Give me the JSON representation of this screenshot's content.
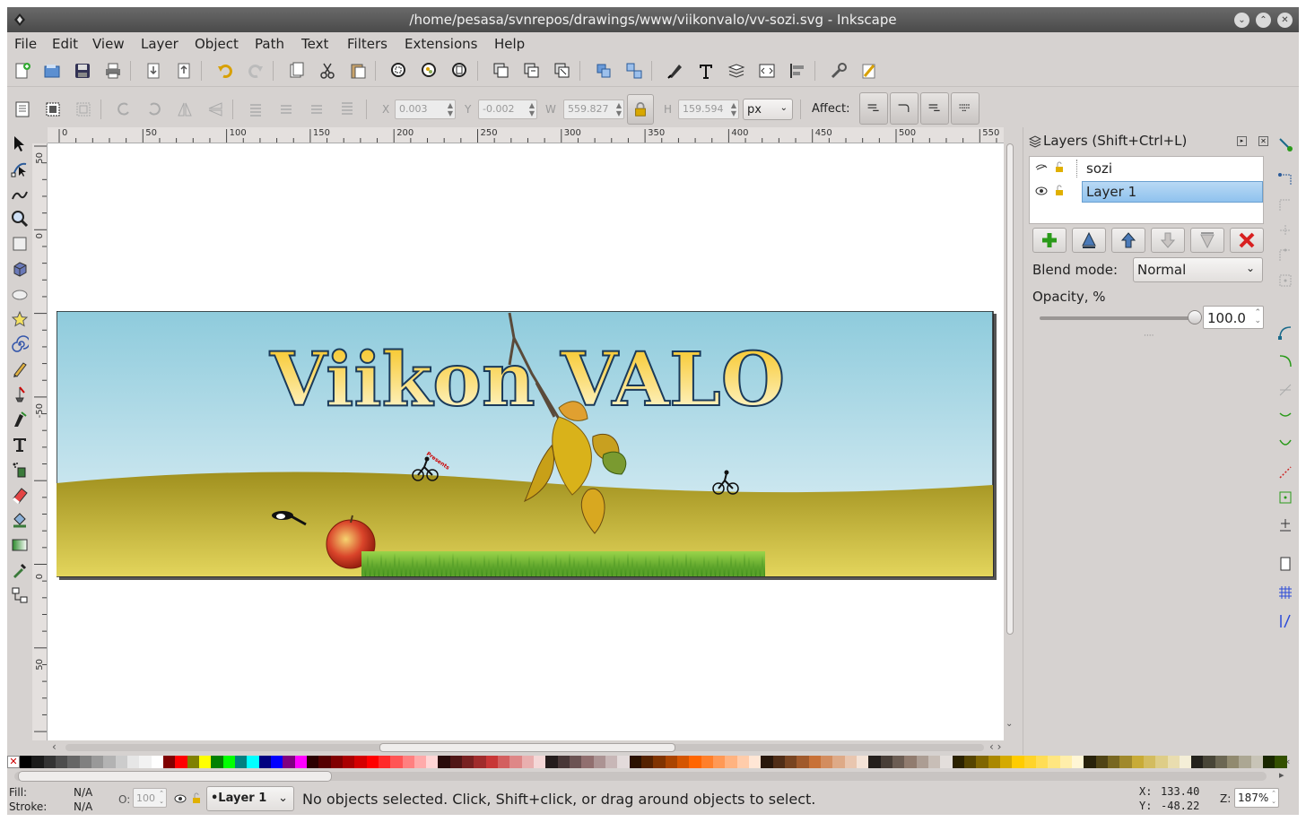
{
  "window": {
    "title": "/home/pesasa/svnrepos/drawings/www/viikonvalo/vv-sozi.svg - Inkscape",
    "buttons": [
      "minimize",
      "maximize",
      "close"
    ]
  },
  "menu": [
    "File",
    "Edit",
    "View",
    "Layer",
    "Object",
    "Path",
    "Text",
    "Filters",
    "Extensions",
    "Help"
  ],
  "toolbar": {
    "x_label": "X",
    "x_value": "0.003",
    "y_label": "Y",
    "y_value": "-0.002",
    "w_label": "W",
    "w_value": "559.827",
    "h_label": "H",
    "h_value": "159.594",
    "unit": "px",
    "affect_label": "Affect:"
  },
  "ruler": {
    "horizontal": [
      "0",
      "50",
      "100",
      "150",
      "200",
      "250",
      "300",
      "350",
      "400",
      "450",
      "500",
      "550"
    ],
    "vertical": [
      "50",
      "0",
      "-50",
      "0",
      "50"
    ]
  },
  "artwork": {
    "title": "Viikon VALO",
    "sign_text": "Presents"
  },
  "layers_panel": {
    "title": "Layers (Shift+Ctrl+L)",
    "layers": [
      {
        "name": "sozi",
        "visible": false,
        "locked": false,
        "selected": false
      },
      {
        "name": "Layer 1",
        "visible": true,
        "locked": false,
        "selected": true
      }
    ],
    "blend_label": "Blend mode:",
    "blend_value": "Normal",
    "opacity_label": "Opacity, %",
    "opacity_value": "100.0",
    "opacity_fraction": 1.0
  },
  "status": {
    "fill_label": "Fill:",
    "fill_value": "N/A",
    "stroke_label": "Stroke:",
    "stroke_value": "N/A",
    "o_label": "O:",
    "o_value": "100",
    "layer_value": "•Layer 1",
    "message": "No objects selected. Click, Shift+click, or drag around objects to select.",
    "x_label": "X:",
    "x_value": "133.40",
    "y_label": "Y:",
    "y_value": "-48.22",
    "z_label": "Z:",
    "zoom_value": "187%"
  },
  "palette": [
    "#000000",
    "#1a1a1a",
    "#333333",
    "#4d4d4d",
    "#666666",
    "#808080",
    "#999999",
    "#b3b3b3",
    "#cccccc",
    "#e6e6e6",
    "#f2f2f2",
    "#ffffff",
    "#800000",
    "#ff0000",
    "#808000",
    "#ffff00",
    "#008000",
    "#00ff00",
    "#008080",
    "#00ffff",
    "#000080",
    "#0000ff",
    "#800080",
    "#ff00ff",
    "#2b0000",
    "#550000",
    "#800000",
    "#aa0000",
    "#d40000",
    "#ff0000",
    "#ff2a2a",
    "#ff5555",
    "#ff8080",
    "#ffaaaa",
    "#ffd5d5",
    "#280b0b",
    "#501616",
    "#782121",
    "#a02c2c",
    "#c83737",
    "#d35f5f",
    "#de8787",
    "#e9afaf",
    "#f4d7d7",
    "#241c1c",
    "#483737",
    "#6c5353",
    "#916f6f",
    "#ac9393",
    "#c8b7b7",
    "#e3dbdb",
    "#2b1100",
    "#552200",
    "#803300",
    "#aa4400",
    "#d45500",
    "#ff6600",
    "#ff7f2a",
    "#ff9955",
    "#ffb380",
    "#ffccaa",
    "#ffe6d5",
    "#28170b",
    "#502d16",
    "#784421",
    "#a05a2c",
    "#c87137",
    "#d38d5f",
    "#deaa87",
    "#e9c6af",
    "#f4e3d7",
    "#241f1c",
    "#483e37",
    "#6c5d53",
    "#917c6f",
    "#ac9d93",
    "#c8beb7",
    "#e3dedb",
    "#2b2200",
    "#554400",
    "#806600",
    "#aa8800",
    "#d4aa00",
    "#ffcc00",
    "#ffd42a",
    "#ffdd55",
    "#ffe680",
    "#ffeeaa",
    "#fff6d5",
    "#28220b",
    "#504416",
    "#786721",
    "#a0892c",
    "#c8ab37",
    "#d3bc5f",
    "#decd87",
    "#e9ddaf",
    "#f4eed7",
    "#24221c",
    "#484537",
    "#6c6753",
    "#918a6f",
    "#aca793",
    "#c8c4b7",
    "#1a2800",
    "#335000"
  ]
}
